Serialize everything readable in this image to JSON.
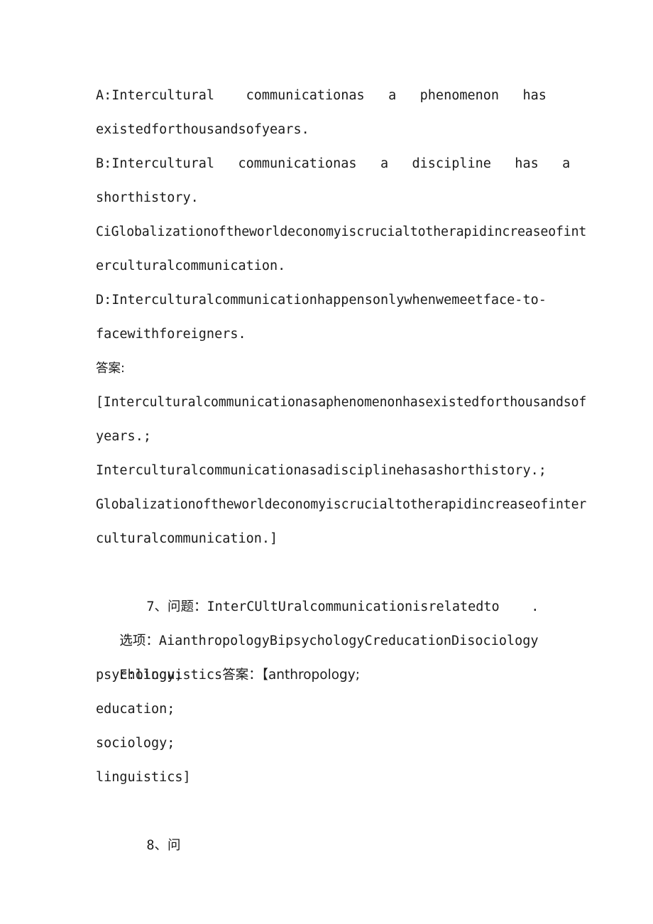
{
  "document": {
    "background_color": "#ffffff",
    "text_color": "#1b1b1b",
    "lines": [
      {
        "id": "opt-a-1",
        "text": "A:Intercultural    communicationas   a   phenomenon   has"
      },
      {
        "id": "opt-a-2",
        "text": "existedforthousandsofyears."
      },
      {
        "id": "opt-b-1",
        "text": "B:Intercultural   communicationas   a   discipline   has   a"
      },
      {
        "id": "opt-b-2",
        "text": "shorthistory."
      },
      {
        "id": "opt-c-1",
        "text": "CiGlobalizationoftheworldeconomyiscrucialtotherapidincreaseofint"
      },
      {
        "id": "opt-c-2",
        "text": "erculturalcommunication."
      },
      {
        "id": "opt-d-1",
        "text": "D:Interculturalcommunicationhappensonlywhenwemeetface-to-"
      },
      {
        "id": "opt-d-2",
        "text": "facewithforeigners."
      },
      {
        "id": "answer-label",
        "text": "答案:"
      },
      {
        "id": "answer-1",
        "text": "[Interculturalcommunicationasaphenomenonhasexistedforthousandsof"
      },
      {
        "id": "answer-2",
        "text": "years.;"
      },
      {
        "id": "answer-3",
        "text": "Interculturalcommunicationasadisciplinehasashorthistory.;"
      },
      {
        "id": "answer-4",
        "text": "Globalizationoftheworldeconomyiscrucialtotherapidincreaseofinter"
      },
      {
        "id": "answer-5",
        "text": "culturalcommunication.]"
      },
      {
        "id": "question-7",
        "number": "7、",
        "label": "问题：",
        "text": "InterCUltUralcommunicationisrelatedto",
        "trailing": "."
      },
      {
        "id": "options-7",
        "label": "选项：",
        "text": "AianthropologyBipsychologyCreducationDisociology"
      },
      {
        "id": "answer-7-head",
        "prefix": "E:linguistics",
        "label": "答案：",
        "text": "【anthropology;"
      },
      {
        "id": "answer-7-b",
        "text": "psychology;"
      },
      {
        "id": "answer-7-c",
        "text": "education;"
      },
      {
        "id": "answer-7-d",
        "text": "sociology;"
      },
      {
        "id": "answer-7-e",
        "text": "linguistics]"
      },
      {
        "id": "question-8",
        "number": "8、",
        "label": "问"
      }
    ]
  }
}
